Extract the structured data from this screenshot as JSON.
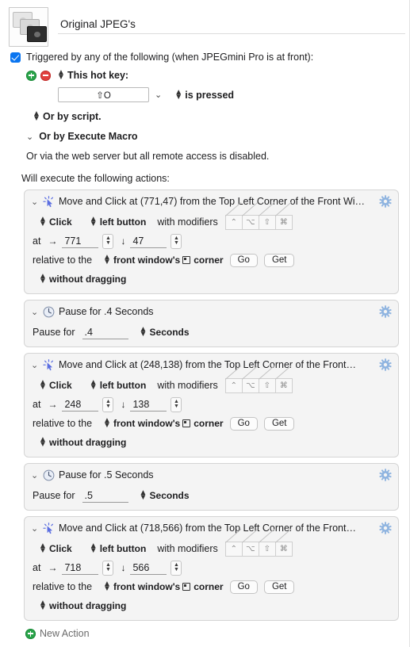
{
  "window": {
    "macro_icon": "stacked-photos-icon",
    "title_value": "Original JPEG's",
    "title_placeholder": "Macro Name"
  },
  "trigger": {
    "enabled": true,
    "checkbox_label": "Triggered by any of the following (when JPEGmini Pro is at front):",
    "add_button": "+",
    "remove_button": "−",
    "hotkey_popup_label": "This hot key:",
    "hotkey_value": "⇧O",
    "hotkey_condition": "is pressed",
    "or_by_script": "Or by script.",
    "or_by_execute_macro": "Or by Execute Macro",
    "web_server_note": "Or via the web server but all remote access is disabled."
  },
  "actions_header": "Will execute the following actions:",
  "new_action_label": "New Action",
  "labels": {
    "click": "Click",
    "button": "left button",
    "with_modifiers": "with modifiers",
    "at": "at",
    "relative_to_the": "relative to the",
    "front_window": "front window's",
    "corner": "corner",
    "go": "Go",
    "get": "Get",
    "dragging": "without dragging",
    "pause_for": "Pause for",
    "seconds": "Seconds"
  },
  "modifiers": [
    {
      "name": "control-modifier",
      "glyph": "⌃",
      "enabled": false
    },
    {
      "name": "option-modifier",
      "glyph": "⌥",
      "enabled": false
    },
    {
      "name": "shift-modifier",
      "glyph": "⇧",
      "enabled": false
    },
    {
      "name": "command-modifier",
      "glyph": "⌘",
      "enabled": false
    }
  ],
  "colors": {
    "accent": "#0a75f0",
    "gear": "#8fb4e0",
    "add_green": "#2aa44a",
    "remove_red": "#e0403e",
    "action_bg": "#f4f4f4",
    "action_border": "#d4d4d4"
  },
  "actions": [
    {
      "type": "move-and-click",
      "icon": "mouse-click-icon",
      "title": "Move and Click at (771,47) from the Top Left Corner of the Front Wi…",
      "click_mode": "Click",
      "mouse_button": "left button",
      "x": "771",
      "y": "47",
      "relative_target": "front window's",
      "drag_mode": "without dragging"
    },
    {
      "type": "pause",
      "icon": "clock-icon",
      "title": "Pause for .4 Seconds",
      "duration": ".4",
      "unit": "Seconds"
    },
    {
      "type": "move-and-click",
      "icon": "mouse-click-icon",
      "title": "Move and Click at (248,138) from the Top Left Corner of the Front…",
      "click_mode": "Click",
      "mouse_button": "left button",
      "x": "248",
      "y": "138",
      "relative_target": "front window's",
      "drag_mode": "without dragging"
    },
    {
      "type": "pause",
      "icon": "clock-icon",
      "title": "Pause for .5 Seconds",
      "duration": ".5",
      "unit": "Seconds"
    },
    {
      "type": "move-and-click",
      "icon": "mouse-click-icon",
      "title": "Move and Click at (718,566) from the Top Left Corner of the Front…",
      "click_mode": "Click",
      "mouse_button": "left button",
      "x": "718",
      "y": "566",
      "relative_target": "front window's",
      "drag_mode": "without dragging"
    }
  ]
}
